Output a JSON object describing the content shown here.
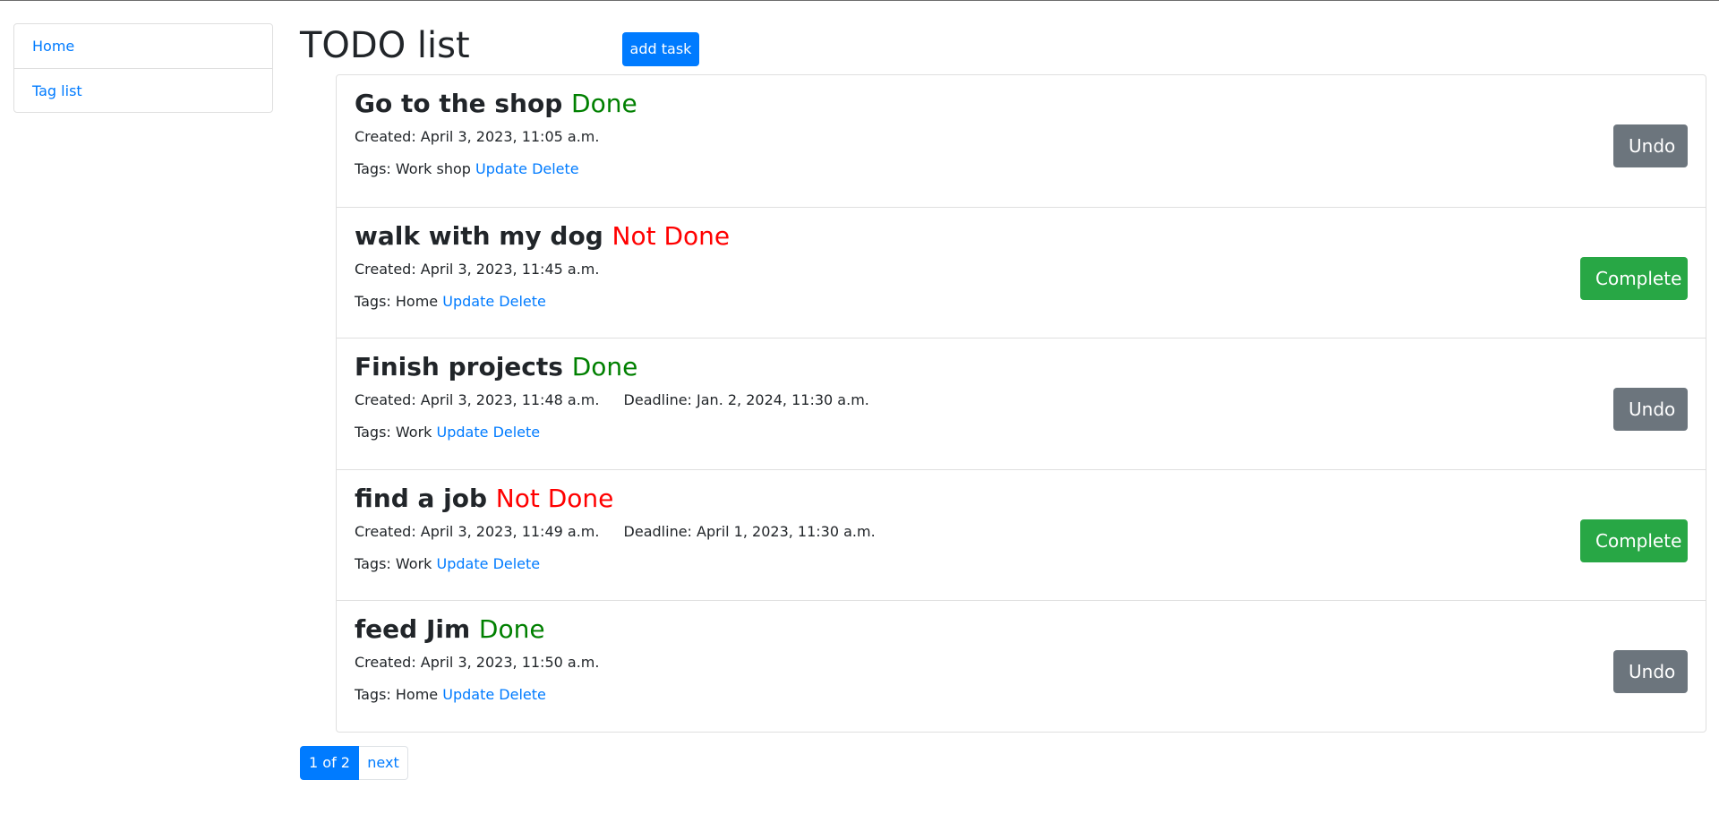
{
  "sidebar": {
    "items": [
      {
        "label": "Home"
      },
      {
        "label": "Tag list"
      }
    ]
  },
  "header": {
    "title": "TODO list",
    "add_task_label": "add task"
  },
  "tasks": [
    {
      "title": "Go to the shop",
      "status": "Done",
      "created": "Created: April 3, 2023, 11:05 a.m.",
      "deadline": "",
      "tags": "Tags: Work shop",
      "update_label": "Update",
      "delete_label": "Delete",
      "action_label": "Undo"
    },
    {
      "title": "walk with my dog",
      "status": "Not Done",
      "created": "Created: April 3, 2023, 11:45 a.m.",
      "deadline": "",
      "tags": "Tags: Home",
      "update_label": "Update",
      "delete_label": "Delete",
      "action_label": "Complete"
    },
    {
      "title": "Finish projects",
      "status": "Done",
      "created": "Created: April 3, 2023, 11:48 a.m.",
      "deadline": "Deadline: Jan. 2, 2024, 11:30 a.m.",
      "tags": "Tags: Work",
      "update_label": "Update",
      "delete_label": "Delete",
      "action_label": "Undo"
    },
    {
      "title": "find a job",
      "status": "Not Done",
      "created": "Created: April 3, 2023, 11:49 a.m.",
      "deadline": "Deadline: April 1, 2023, 11:30 a.m.",
      "tags": "Tags: Work",
      "update_label": "Update",
      "delete_label": "Delete",
      "action_label": "Complete"
    },
    {
      "title": "feed Jim",
      "status": "Done",
      "created": "Created: April 3, 2023, 11:50 a.m.",
      "deadline": "",
      "tags": "Tags: Home",
      "update_label": "Update",
      "delete_label": "Delete",
      "action_label": "Undo"
    }
  ],
  "pagination": {
    "current": "1 of 2",
    "next_label": "next"
  },
  "colors": {
    "primary": "#007bff",
    "done": "#008000",
    "not_done": "#ff0000",
    "undo": "#6c757d",
    "complete": "#28a745"
  }
}
